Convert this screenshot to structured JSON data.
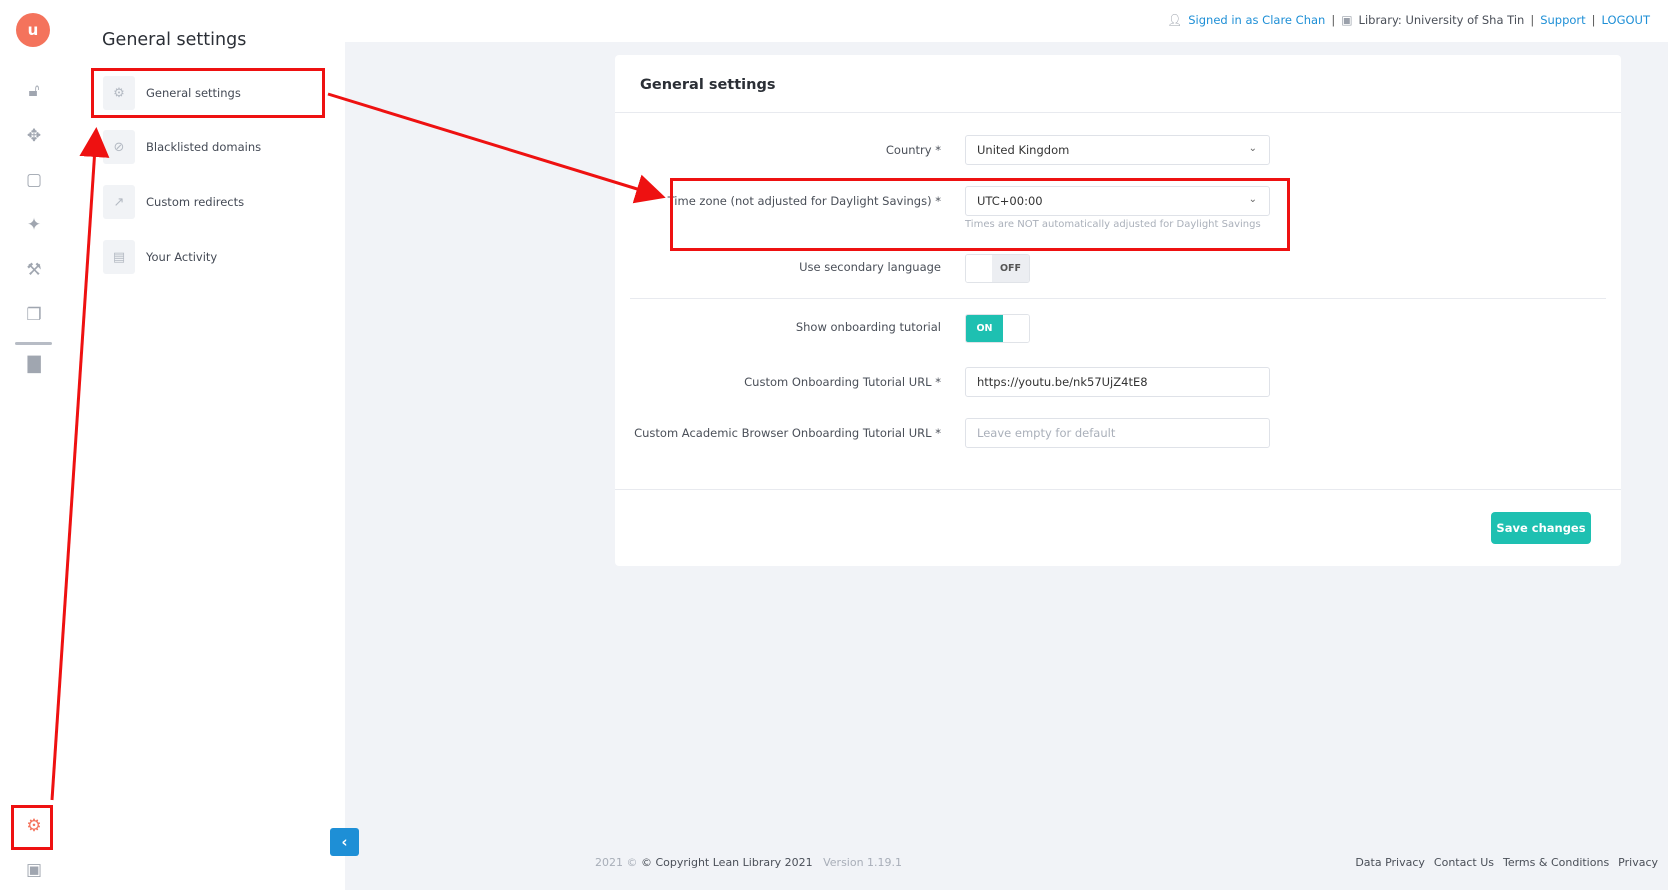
{
  "app": {
    "logo_text": "u",
    "brand_color": "#f4735c",
    "accent_color": "#1ec0b1",
    "link_color": "#1e8fd6"
  },
  "rail": {
    "icons": [
      "unlock-icon",
      "move-icon",
      "chat-icon",
      "puzzle-icon",
      "tools-icon",
      "stack-icon",
      "bar-chart-icon",
      "gear-icon",
      "computer-user-icon"
    ]
  },
  "topbar": {
    "signed_in": "Signed in as Clare Chan",
    "library": "Library: University of Sha Tin",
    "support": "Support",
    "logout": "LOGOUT",
    "separator": "|"
  },
  "submenu": {
    "title": "General settings",
    "items": [
      {
        "label": "General settings",
        "icon": "gear-icon"
      },
      {
        "label": "Blacklisted domains",
        "icon": "ban-icon"
      },
      {
        "label": "Custom redirects",
        "icon": "external-link-icon"
      },
      {
        "label": "Your Activity",
        "icon": "clipboard-icon"
      }
    ]
  },
  "card": {
    "title": "General settings",
    "country": {
      "label": "Country *",
      "value": "United Kingdom"
    },
    "timezone": {
      "label": "Time zone (not adjusted for Daylight Savings) *",
      "value": "UTC+00:00",
      "hint": "Times are NOT automatically adjusted for Daylight Savings"
    },
    "secondary_language": {
      "label": "Use secondary language",
      "state": "OFF"
    },
    "onboarding": {
      "label": "Show onboarding tutorial",
      "state": "ON"
    },
    "custom_url": {
      "label": "Custom Onboarding Tutorial URL *",
      "value": "https://youtu.be/nk57UjZ4tE8"
    },
    "academic_url": {
      "label": "Custom Academic Browser Onboarding Tutorial URL *",
      "placeholder": "Leave empty for default"
    },
    "save_label": "Save changes"
  },
  "footer": {
    "year": "2021 ©",
    "copyright": "© Copyright Lean Library 2021",
    "version": "Version 1.19.1",
    "links": [
      "Data Privacy",
      "Contact Us",
      "Terms & Conditions",
      "Privacy"
    ]
  }
}
